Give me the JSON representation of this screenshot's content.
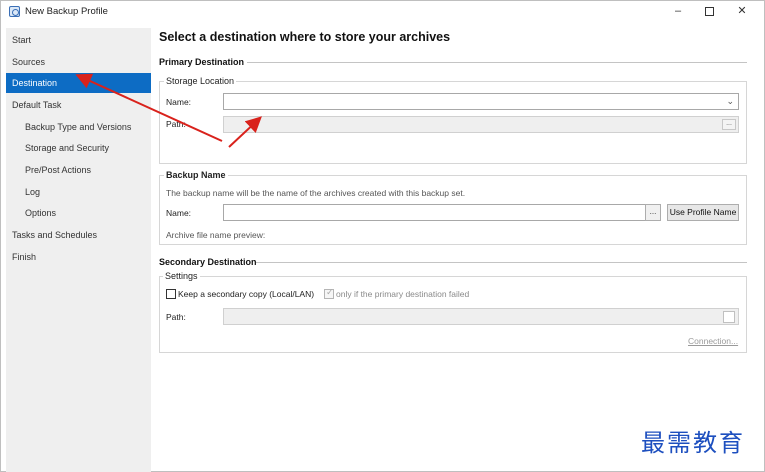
{
  "window": {
    "title": "New Backup Profile",
    "min_label": "–",
    "close_label": "✕"
  },
  "sidebar": {
    "items": [
      {
        "label": "Start"
      },
      {
        "label": "Sources"
      },
      {
        "label": "Destination",
        "active": true
      },
      {
        "label": "Default Task"
      },
      {
        "label": "Backup Type and Versions"
      },
      {
        "label": "Storage and Security"
      },
      {
        "label": "Pre/Post Actions"
      },
      {
        "label": "Log"
      },
      {
        "label": "Options"
      },
      {
        "label": "Tasks and Schedules"
      },
      {
        "label": "Finish"
      }
    ]
  },
  "main": {
    "title": "Select a destination where to store your archives",
    "primary": {
      "heading": "Primary Destination",
      "group_label": "Storage Location",
      "name_label": "Name:",
      "name_value": "",
      "path_label": "Path:",
      "path_value": "",
      "browse_label": "..."
    },
    "backup_name": {
      "heading": "Backup Name",
      "description": "The backup name will be the name of the archives created with this backup set.",
      "name_label": "Name:",
      "name_value": "",
      "browse_label": "...",
      "use_profile_button": "Use Profile Name",
      "preview_label": "Archive file name preview:"
    },
    "secondary": {
      "heading": "Secondary Destination",
      "group_label": "Settings",
      "keep_copy_label": "Keep a secondary copy (Local/LAN)",
      "keep_copy_checked": false,
      "only_if_failed_label": "only if the primary destination failed",
      "only_if_failed_checked": true,
      "path_label": "Path:",
      "path_value": "",
      "connection_link": "Connection..."
    }
  },
  "watermark": "最需教育",
  "colors": {
    "accent": "#0d6cc4",
    "sidebar_bg": "#efefef",
    "annotation_arrow": "#d9221c",
    "watermark": "#1d4fbf"
  }
}
